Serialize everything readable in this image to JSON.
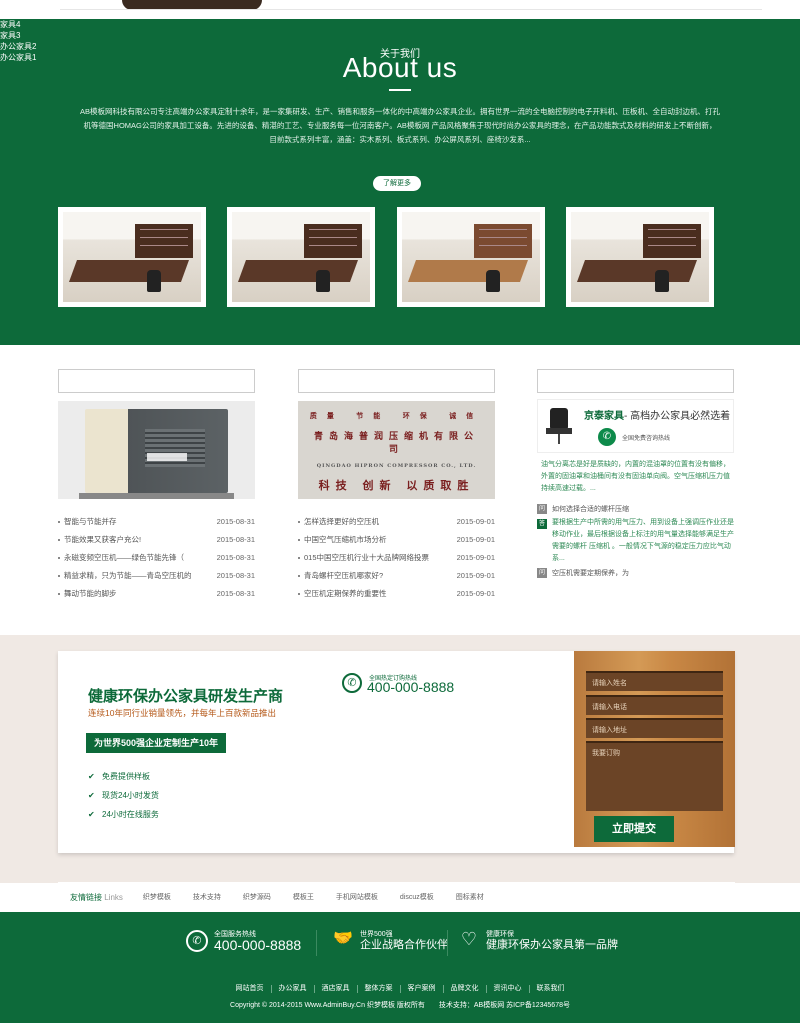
{
  "about": {
    "title_cn": "关于我们",
    "title_en": "About us",
    "description": "AB模板网科技有限公司专注高端办公家具定制十余年，是一家集研发、生产、销售和服务一体化的中高端办公家具企业。拥有世界一流的全电脑控制的电子开料机、压板机、全自动封边机、打孔机等德国HOMAG公司的家具加工设备。先进的设备、精湛的工艺、专业服务每一位河南客户。AB模板网 产品风格聚焦于现代时尚办公家具的理念，在产品功能款式及材料的研发上不断创新，目前款式系列丰富，涵盖：实木系列、板式系列、办公屏风系列、座椅沙发系...",
    "more_button": "了解更多",
    "products": [
      {
        "caption": "家具4"
      },
      {
        "caption": "家具3"
      },
      {
        "caption": "办公家具2"
      },
      {
        "caption": "办公家具1"
      }
    ]
  },
  "news": {
    "col1": {
      "items": [
        {
          "title": "智能与节能并存",
          "date": "2015-08-31"
        },
        {
          "title": "节能效果又获客户充公!",
          "date": "2015-08-31"
        },
        {
          "title": "永磁变频空压机——绿色节能先锋（",
          "date": "2015-08-31"
        },
        {
          "title": "精益求精，只为节能——青岛空压机的",
          "date": "2015-08-31"
        },
        {
          "title": "舞动节能的脚步",
          "date": "2015-08-31"
        }
      ]
    },
    "col2": {
      "plaque_top": "质量 节能 环保 诚信",
      "plaque_name": "青岛海普润压缩机有限公司",
      "plaque_en": "QINGDAO HIPRON COMPRESSOR CO., LTD.",
      "plaque_bottom": "科技 创新 以质取胜",
      "items": [
        {
          "title": "怎样选择更好的空压机",
          "date": "2015-09-01"
        },
        {
          "title": "中国空气压缩机市场分析",
          "date": "2015-09-01"
        },
        {
          "title": "015中国空压机行业十大品牌网络投票",
          "date": "2015-09-01"
        },
        {
          "title": "青岛螺杆空压机哪家好?",
          "date": "2015-09-01"
        },
        {
          "title": "空压机定期保养的重要性",
          "date": "2015-09-01"
        }
      ]
    },
    "col3": {
      "banner_brand": "京泰家具",
      "banner_slogan": "- 高档办公家具必然选着",
      "banner_hotline": "全国免费咨询热线",
      "para": "油气分离芯是好是质缺的，内置的混油罩的位置有没有偏移，外置的固油罩和油桶间有没有固油单向阀。空气压缩机压力值持续高速过载。...",
      "q1": "如何选择合适的螺杆压缩",
      "a1": "要根据生产中所需的用气压力、用到设备上强调压作业还是移动作业，最后根据设备上标注的用气量选择能够满足生产需要的螺杆 压缩机 。一般情况下气源的稳定压力应比气动系...",
      "q2": "空压机需要定期保养，为",
      "q_badge": "问",
      "a_badge": "答"
    }
  },
  "contact": {
    "headline": "健康环保办公家具研发生产商",
    "subline": "连续10年同行业销量领先，并每年上百款新品推出",
    "tag": "为世界500强企业定制生产10年",
    "features": [
      "免费提供样板",
      "现货24小时发货",
      "24小时在线服务"
    ],
    "hotline_label": "全国热定订购热线",
    "hotline_number": "400-000-8888",
    "form": {
      "name_placeholder": "请输入姓名",
      "phone_placeholder": "请输入电话",
      "address_placeholder": "请输入地址",
      "message_placeholder": "我要订购",
      "submit": "立即提交"
    }
  },
  "links": {
    "label": "友情链接",
    "label_en": "Links",
    "items": [
      "织梦模板",
      "技术支持",
      "织梦源码",
      "模板王",
      "手机网站模板",
      "discuz模板",
      "图标素材"
    ]
  },
  "footer": {
    "f1_small": "全国服务热线",
    "f1_big": "400-000-8888",
    "f2_small": "世界500强",
    "f2_big": "企业战略合作伙伴",
    "f3_small": "健康环保",
    "f3_big": "健康环保办公家具第一品牌",
    "nav": [
      "网站首页",
      "办公家具",
      "酒店家具",
      "整体方案",
      "客户案例",
      "品牌文化",
      "资讯中心",
      "联系我们"
    ],
    "copyright": "Copyright © 2014-2015 Www.AdminBuy.Cn 织梦模板 版权所有　　技术支持：AB模板网 苏ICP备12345678号"
  }
}
